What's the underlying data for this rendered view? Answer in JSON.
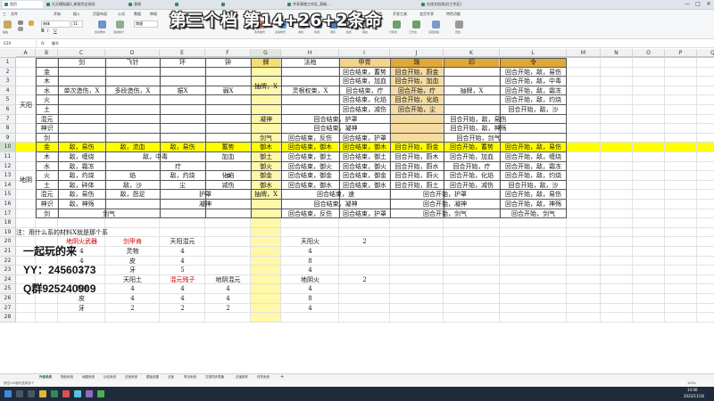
{
  "colors": {
    "header_fill": "#e0a838",
    "selection_highlight": "#ffff00",
    "grid": "#e2e2e2",
    "red_text": "#cc0000",
    "taskbar": "#1f2b3a"
  },
  "overlay_title": "第三个档 第14+26+2条命",
  "tabs": [
    "首页",
    "天天模拟器1_新版完全测试",
    "表格",
    "",
    "",
    "共享表格工作区_表格...",
    "在线文档测试(工作区)"
  ],
  "window_controls": [
    "—",
    "□",
    "✕"
  ],
  "ribbon": {
    "menus": [
      "三",
      "文件",
      "",
      "开始",
      "插入",
      "页面布局",
      "公式",
      "数据",
      "审阅",
      "视图",
      "开发工具",
      "会员专享",
      "特色功能"
    ],
    "tools": [
      "粘贴",
      "剪切",
      "复制",
      "格式刷",
      "宋体",
      "11",
      "B",
      "I",
      "U",
      "合并居中",
      "自动换行",
      "常规",
      "条件格式",
      "表格样式",
      "求和",
      "筛选",
      "排序",
      "格式",
      "填充",
      "行和列",
      "工作表",
      "冻结窗格",
      "查找"
    ]
  },
  "formula_bar": {
    "cell_ref": "G10",
    "fx": "fx",
    "content": "御木"
  },
  "col_headers": [
    "A",
    "B",
    "C",
    "D",
    "E",
    "F",
    "G",
    "H",
    "I",
    "J",
    "K",
    "L",
    "M",
    "N",
    "O",
    "P",
    "Q"
  ],
  "row_headers": [
    "1",
    "2",
    "3",
    "4",
    "5",
    "6",
    "7",
    "8",
    "9",
    "10",
    "11",
    "12",
    "13",
    "14",
    "15",
    "16",
    "17",
    "18",
    "19",
    "20",
    "21",
    "22",
    "23",
    "24",
    "25",
    "26",
    "27",
    "28"
  ],
  "header_row": {
    "C": "剑",
    "D": "飞针",
    "E": "环",
    "F": "钟",
    "G": "牌",
    "H": "法袍",
    "I": "甲胄",
    "J": "珠",
    "K": "印",
    "L": "令"
  },
  "upper": {
    "group": "天阳",
    "elements": [
      "金",
      "木",
      "水",
      "火",
      "土",
      "混元",
      "神识",
      "剑"
    ],
    "C": "单次造伤，X",
    "D": "多段造伤，X",
    "E": "振X",
    "F": "弱X",
    "G_top": "抽牌，X",
    "G6": "凝神",
    "G8": "剑气",
    "H_top": "灵根权束，X",
    "I": [
      "回合结束，蓄势",
      "回合结束，加血",
      "回合结束，疗",
      "回合结束，化焰",
      "回合结束，减伤"
    ],
    "J": [
      "回合开始，蔚金",
      "回合开始，加血",
      "回合开始，疗",
      "回合开始，化焰",
      "回合开始，尘"
    ],
    "K": "抽牌，X",
    "L": [
      "回合开始，敌，易伤",
      "回合开始，敌，中毒",
      "回合开始，敌，霜冻",
      "回合开始，敌，灼烧",
      "回合开始，敌，沙"
    ],
    "HI6": "回合结束，护罩",
    "JL6": "回合开始，敌，易伤",
    "HI7": "回合结束，凝神",
    "JL7": "回合开始，敌，神殇",
    "H8": "回合结束，反伤",
    "I8": "回合结束，护罩",
    "JL8": "回合开始，剑气"
  },
  "lower": {
    "group": "地阴",
    "elements": [
      "金",
      "木",
      "水",
      "火",
      "土",
      "混元",
      "神识",
      "剑"
    ],
    "rows": [
      {
        "C": "敌，易伤",
        "D": "敌，流血",
        "E": "敌，易伤",
        "F": "蓄势",
        "G": "御木",
        "H": "回合结束，御木",
        "I": "回合结束，御木",
        "J": "回合开始，蔚金",
        "K": "回合开始，蓄势",
        "L": "回合开始，敌，易伤"
      },
      {
        "C": "敌，缠绕",
        "DE": "敌，中毒",
        "F": "加血",
        "G": "御土",
        "H": "回合结束，御土",
        "I": "回合结束，御土",
        "J": "回合开始，蔚木",
        "K": "回合开始，加血",
        "L": "回合开始，敌，缠绕"
      },
      {
        "C": "敌，霜冻",
        "DF": "疗",
        "G": "御火",
        "H": "回合结束，御火",
        "I": "回合结束，御火",
        "J": "回合开始，蔚水",
        "K": "回合开始，疗",
        "L": "回合开始，敌，霜冻"
      },
      {
        "C": "敌，灼烧",
        "D": "焰",
        "E": "敌，灼烧",
        "F": "化焰",
        "G": "御金",
        "H": "回合结束，御金",
        "I": "回合结束，御金",
        "J": "回合开始，蔚火",
        "K": "回合开始，化焰",
        "L": "回合开始，敌，灼烧"
      },
      {
        "C": "敌，碎体",
        "D": "敌，沙",
        "E": "尘",
        "F": "减伤",
        "G": "御水",
        "H": "回合结束，御水",
        "I": "回合结束，御水",
        "J": "回合开始，蔚土",
        "K": "回合开始，减伤",
        "L": "回合开始，敌，沙"
      },
      {
        "C": "敌，易伤",
        "D": "敌，怨足",
        "EF": "护罩",
        "G": "抽牌，X",
        "HI": "回合结束，速",
        "JK": "回合开始，护罩",
        "L": "回合开始，敌，易伤"
      },
      {
        "C": "敌，神殇",
        "EF": "凝神",
        "HI": "回合结束，凝神",
        "JK": "回合开始，凝神",
        "L": "回合开始，敌，神殇"
      },
      {
        "CD": "剑气",
        "H": "回合结束，反伤",
        "I": "回合结束，护罩",
        "JK": "回合开始，剑气",
        "L": "回合开始，剑气"
      }
    ]
  },
  "note": "注：用什么系的材料X就是那个系",
  "materials_1": {
    "h1": "地阴火武器",
    "h2": "剑甲肯",
    "h3": "天阳混元",
    "rows": [
      [
        "4",
        "灵物",
        "4"
      ],
      [
        "4",
        "皮",
        "4"
      ],
      [
        "2",
        "牙",
        "5"
      ]
    ]
  },
  "materials_right": {
    "h": "天阳火",
    "v2": "2",
    "vals": [
      "4",
      "8",
      "4"
    ]
  },
  "materials_2": {
    "h1": "天阳土",
    "h2": "混元残子",
    "h3": "地阴混元",
    "rows": [
      [
        "灵物",
        "4",
        "4",
        "4"
      ],
      [
        "皮",
        "4",
        "4",
        "4"
      ],
      [
        "牙",
        "2",
        "2",
        "2"
      ]
    ]
  },
  "materials_right2": {
    "h": "地阴火",
    "v2": "2",
    "vals": [
      "4",
      "8",
      "4"
    ]
  },
  "promo": {
    "line1": "一起玩的来",
    "line2": "YY：24560373",
    "line3": "Q群925240909"
  },
  "sheet_tabs": [
    "升级系统",
    "物品系统",
    "地图系统",
    "功法系统",
    "法宝系统",
    "模板设置",
    "法宝",
    "阵法系统",
    "文档同步表格",
    "法宝制作",
    "任务系统",
    "+"
  ],
  "status": {
    "left": "按住Ctrl键可选择多个",
    "right": "100%"
  },
  "taskbar": {
    "time": "14:06",
    "date": "2022/11/16"
  }
}
